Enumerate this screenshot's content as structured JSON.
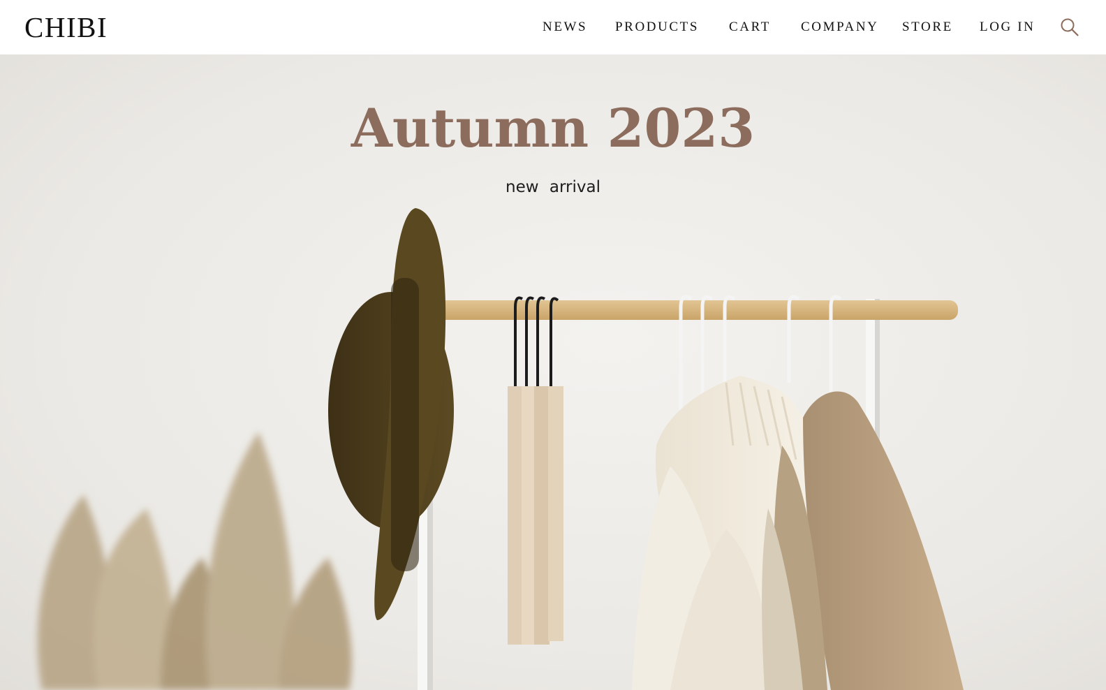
{
  "brand": {
    "logo_text": "CHIBI"
  },
  "nav": {
    "items": [
      {
        "label": "NEWS"
      },
      {
        "label": "PRODUCTS"
      },
      {
        "label": "CART"
      },
      {
        "label": "COMPANY"
      },
      {
        "label": "STORE"
      },
      {
        "label": "LOG IN"
      }
    ],
    "search_icon": "search-icon"
  },
  "hero": {
    "title": "Autumn 2023",
    "subtitle": "new  arrival",
    "image_subject": "clothing rack with hat, hangers and pampas grass"
  },
  "colors": {
    "title": "#8c6c5c",
    "nav_text": "#111111",
    "search_icon": "#8c6c5c",
    "hero_background": "#ebe9e5"
  }
}
